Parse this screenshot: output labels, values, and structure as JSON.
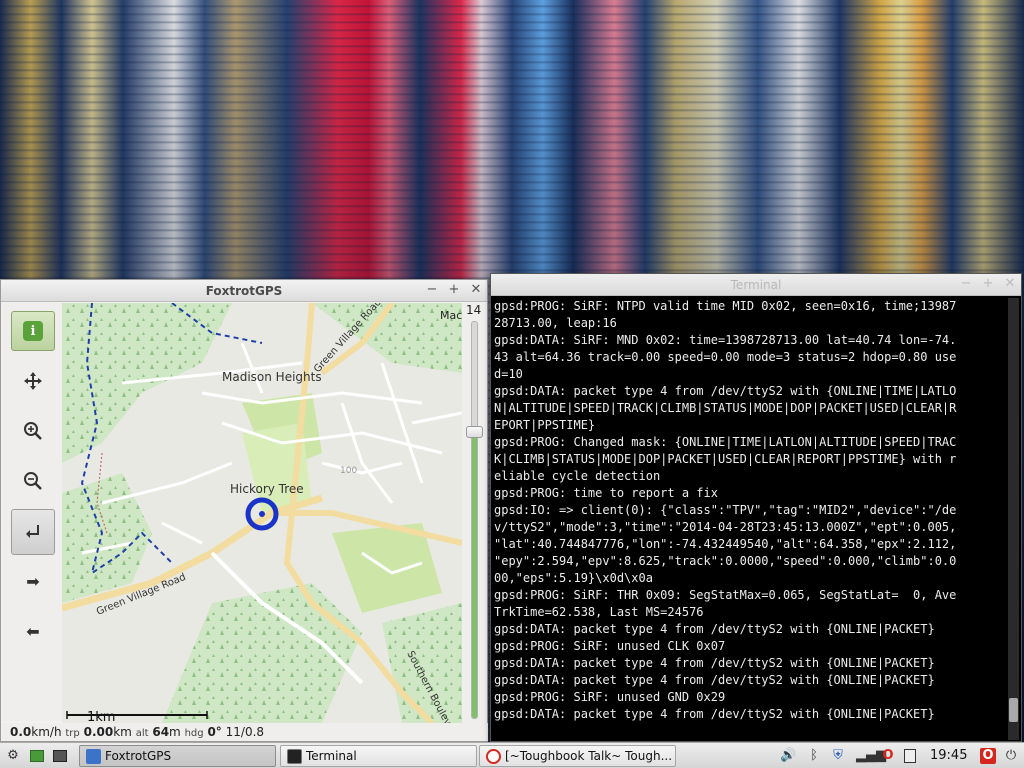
{
  "foxtrot": {
    "title": "FoxtrotGPS",
    "zoom_level": "14",
    "zoom_fraction": 0.72,
    "map": {
      "labels": {
        "madison": "Madison Heights",
        "hickory": "Hickory Tree",
        "green_village_top": "Green Village Road",
        "green_village_bottom": "Green Village Road",
        "southern": "Southern Boulev",
        "mac": "Mac",
        "route": "100",
        "scale": "1km"
      }
    },
    "status": {
      "speed": "0.0",
      "speed_unit": "km/h",
      "trip_label": "trp",
      "trip": "0.00",
      "trip_unit": "km",
      "alt_label": "alt",
      "alt": "64",
      "alt_unit": "m",
      "hdg_label": "hdg",
      "hdg": "0°",
      "sats": "11/0.8"
    }
  },
  "terminal": {
    "title": "Terminal",
    "lines": [
      "gpsd:PROG: SiRF: NTPD valid time MID 0x02, seen=0x16, time;13987",
      "28713.00, leap:16",
      "gpsd:DATA: SiRF: MND 0x02: time=1398728713.00 lat=40.74 lon=-74.",
      "43 alt=64.36 track=0.00 speed=0.00 mode=3 status=2 hdop=0.80 use",
      "d=10",
      "gpsd:DATA: packet type 4 from /dev/ttyS2 with {ONLINE|TIME|LATLO",
      "N|ALTITUDE|SPEED|TRACK|CLIMB|STATUS|MODE|DOP|PACKET|USED|CLEAR|R",
      "EPORT|PPSTIME}",
      "gpsd:PROG: Changed mask: {ONLINE|TIME|LATLON|ALTITUDE|SPEED|TRAC",
      "K|CLIMB|STATUS|MODE|DOP|PACKET|USED|CLEAR|REPORT|PPSTIME} with r",
      "eliable cycle detection",
      "gpsd:PROG: time to report a fix",
      "gpsd:IO: => client(0): {\"class\":\"TPV\",\"tag\":\"MID2\",\"device\":\"/de",
      "v/ttyS2\",\"mode\":3,\"time\":\"2014-04-28T23:45:13.000Z\",\"ept\":0.005,",
      "\"lat\":40.744847776,\"lon\":-74.432449540,\"alt\":64.358,\"epx\":2.112,",
      "\"epy\":2.594,\"epv\":8.625,\"track\":0.0000,\"speed\":0.000,\"climb\":0.0",
      "00,\"eps\":5.19}\\x0d\\x0a",
      "gpsd:PROG: SiRF: THR 0x09: SegStatMax=0.065, SegStatLat=  0, Ave",
      "TrkTime=62.538, Last MS=24576",
      "gpsd:DATA: packet type 4 from /dev/ttyS2 with {ONLINE|PACKET}",
      "gpsd:PROG: SiRF: unused CLK 0x07",
      "gpsd:DATA: packet type 4 from /dev/ttyS2 with {ONLINE|PACKET}",
      "gpsd:DATA: packet type 4 from /dev/ttyS2 with {ONLINE|PACKET}",
      "gpsd:PROG: SiRF: unused GND 0x29",
      "gpsd:DATA: packet type 4 from /dev/ttyS2 with {ONLINE|PACKET}"
    ]
  },
  "taskbar": {
    "tasks": [
      {
        "label": "FoxtrotGPS",
        "icon": "foxtrot-icon",
        "active": true
      },
      {
        "label": "Terminal",
        "icon": "terminal-icon",
        "active": false
      },
      {
        "label": "[~Toughbook Talk~ Tough...",
        "icon": "opera-icon",
        "active": false
      }
    ],
    "clock": "19:45",
    "colors": {
      "opera_red": "#d6271e",
      "volume": "#333333"
    }
  }
}
